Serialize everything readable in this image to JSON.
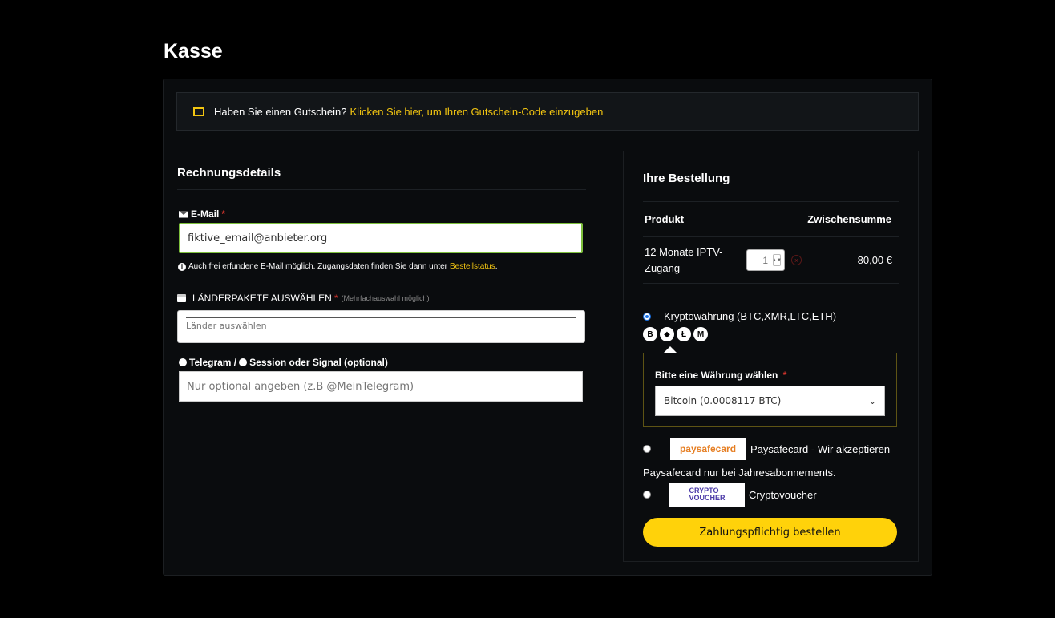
{
  "page": {
    "title": "Kasse"
  },
  "coupon": {
    "text": "Haben Sie einen Gutschein?",
    "link": "Klicken Sie hier, um Ihren Gutschein-Code einzugeben"
  },
  "billing": {
    "heading": "Rechnungsdetails",
    "email": {
      "label": "E-Mail",
      "required": "*",
      "value": "fiktive_email@anbieter.org",
      "hint": "Auch frei erfundene E-Mail möglich. Zugangsdaten finden Sie dann unter",
      "hint_link": "Bestellstatus",
      "hint_end": "."
    },
    "packages": {
      "label": "LÄNDERPAKETE AUSWÄHLEN",
      "required": "*",
      "note": "(Mehrfachauswahl möglich)",
      "placeholder": "Länder auswählen"
    },
    "telegram": {
      "label": "Telegram /",
      "label2": "Session oder Signal (optional)",
      "placeholder": "Nur optional angeben (z.B @MeinTelegram)"
    }
  },
  "order": {
    "heading": "Ihre Bestellung",
    "col_product": "Produkt",
    "col_subtotal": "Zwischensumme",
    "item": {
      "name": "12 Monate IPTV-Zugang",
      "qty": "1",
      "price": "80,00 €",
      "remove": "×"
    },
    "payment": {
      "crypto": {
        "label": "Kryptowährung (BTC,XMR,LTC,ETH)",
        "coins": [
          "B",
          "◆",
          "Ł",
          "M"
        ],
        "select_label": "Bitte eine Währung wählen",
        "required": "*",
        "selected": "Bitcoin (0.0008117 BTC)"
      },
      "paysafe": {
        "logo_a": "paysafe",
        "logo_b": "card",
        "label": "Paysafecard - Wir akzeptieren",
        "label_cont": "Paysafecard nur bei Jahresabonnements."
      },
      "cryptovoucher": {
        "logo_a": "CRYPTO",
        "logo_b": "VOUCHER",
        "label": "Cryptovoucher"
      }
    },
    "submit": "Zahlungspflichtig bestellen"
  },
  "colors": {
    "accent": "#ffd20a",
    "link": "#f2c511",
    "background": "#000000",
    "panel": "#0a0c0e"
  }
}
